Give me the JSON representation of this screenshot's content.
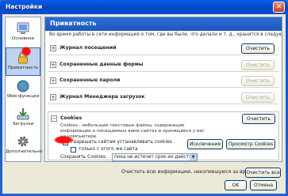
{
  "window": {
    "title": "Настройки"
  },
  "sidebar": {
    "items": [
      {
        "label": "Основное"
      },
      {
        "label": "Приватность"
      },
      {
        "label": "Web-функции"
      },
      {
        "label": "Загрузки"
      },
      {
        "label": "Дополнительно"
      }
    ]
  },
  "content": {
    "header": "Приватность",
    "intro": "Во время работы в сети информация о том, где вы были, что делали и т. д., хранится в следующих местах.",
    "sections": [
      {
        "title": "Журнал посещений",
        "button": "Очистить",
        "button_enabled": true
      },
      {
        "title": "Сохраненные данные формы",
        "button": "Очистить",
        "button_enabled": false
      },
      {
        "title": "Сохраненные пароли",
        "button": "Очистить",
        "button_enabled": false
      },
      {
        "title": "Журнал Менеджера загрузок",
        "button": "Очистить",
        "button_enabled": false
      }
    ],
    "cookies": {
      "title": "Cookies",
      "clear_button": "Очистить",
      "description": "Cookies - небольшие текстовые файлы, содержащие информацию о посещаемых вами сайтах и хранящиеся у вас на компьютере.",
      "allow_label": "Разрешать сайтам устанавливать cookies",
      "allow_checked": true,
      "same_site_label": "только с этого же сайта",
      "same_site_checked": false,
      "exceptions_button": "Исключения",
      "view_button": "Просмотр Cookies",
      "keep_label": "Сохранять Cookies:",
      "keep_value": "пока не истечет срок их действия"
    },
    "clear_all_label": "Очистить всю информацию, накопившуюся за время работы:",
    "clear_all_button": "Очистить все"
  },
  "footer": {
    "ok": "OK",
    "cancel": "Отмена",
    "help": "Справка"
  }
}
